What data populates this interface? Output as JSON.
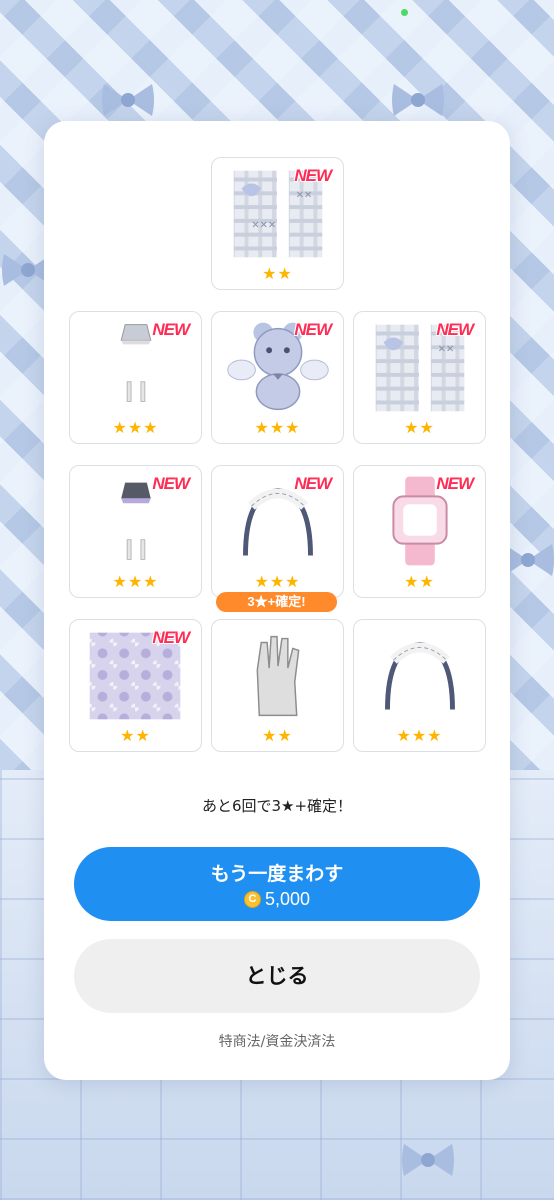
{
  "items": [
    {
      "stars": "★★",
      "is_new": true,
      "new_label": "NEW",
      "icon": "patchwork-fabric-icon"
    },
    {
      "stars": "★★★",
      "is_new": true,
      "new_label": "NEW",
      "icon": "skirt-and-socks-icon"
    },
    {
      "stars": "★★★",
      "is_new": true,
      "new_label": "NEW",
      "icon": "angel-bear-plush-icon"
    },
    {
      "stars": "★★",
      "is_new": true,
      "new_label": "NEW",
      "icon": "patchwork-fabric-icon"
    },
    {
      "stars": "★★★",
      "is_new": true,
      "new_label": "NEW",
      "icon": "dark-skirt-and-socks-icon"
    },
    {
      "stars": "★★★",
      "is_new": true,
      "new_label": "NEW",
      "icon": "maid-headband-icon"
    },
    {
      "stars": "★★",
      "is_new": true,
      "new_label": "NEW",
      "icon": "pink-watch-icon"
    },
    {
      "stars": "★★",
      "is_new": true,
      "new_label": "NEW",
      "icon": "floral-fabric-icon"
    },
    {
      "stars": "★★",
      "is_new": false,
      "icon": "glove-hand-icon"
    },
    {
      "stars": "★★★",
      "is_new": false,
      "icon": "maid-headband-icon"
    }
  ],
  "guarantee_badge": "3★+確定!",
  "remaining_text": "あと6回で3★+確定！",
  "spin_again": {
    "label": "もう一度まわす",
    "coin_symbol": "C",
    "price": "5,000"
  },
  "close_label": "とじる",
  "legal_link": "特商法/資金決済法",
  "colors": {
    "primary": "#1f8ff2",
    "new": "#ff2d55",
    "star": "#ffb400",
    "badge": "#ff8a2b"
  }
}
